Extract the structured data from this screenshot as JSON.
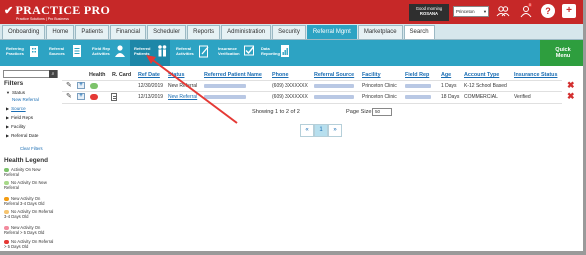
{
  "header": {
    "logo_text": "PRACTICE PRO",
    "logo_sub": "Practice Solutions | Pro Business",
    "greeting_line1": "Good morning",
    "greeting_name": "ROSANA",
    "clinic": "Princeton",
    "badge_count": "0",
    "help_icon": "help-icon",
    "colors": {
      "header_bg": "#c62828",
      "nav_active": "#2da3c3",
      "quick_menu": "#2e9e3e"
    }
  },
  "tabs": [
    "Onboarding",
    "Home",
    "Patients",
    "Financial",
    "Scheduler",
    "Reports",
    "Administration",
    "Security",
    "Referral Mgmt",
    "Marketplace",
    "Search"
  ],
  "subnav": [
    {
      "label1": "Referring",
      "label2": "Practices"
    },
    {
      "label1": "Referral",
      "label2": "Sources"
    },
    {
      "label1": "Field Rep",
      "label2": "Activities"
    },
    {
      "label1": "Referred",
      "label2": "Patients"
    },
    {
      "label1": "Referral",
      "label2": "Activities"
    },
    {
      "label1": "Insurance",
      "label2": "Verification"
    },
    {
      "label1": "Data",
      "label2": "Reporting"
    }
  ],
  "quick_menu": {
    "line1": "Quick",
    "line2": "Menu"
  },
  "filters": {
    "title": "Filters",
    "items": [
      "Status",
      "Source",
      "Field Reps",
      "Facility",
      "Referral Date"
    ],
    "status_value": "New Referral",
    "clear": "Clear Filters"
  },
  "health_legend": {
    "title": "Health Legend",
    "items": [
      {
        "text1": "Activity On New",
        "text2": "Referral",
        "color": "#7dc36b"
      },
      {
        "text1": "No Activity On New",
        "text2": "Referral",
        "color": "#a8d98a"
      },
      {
        "text1": "New Activity On",
        "text2": "Referral 3-4 Days Old",
        "color": "#f39c12"
      },
      {
        "text1": "No Activity On Referral",
        "text2": "3-4 Days Old",
        "color": "#f5c46f"
      },
      {
        "text1": "New Activity On",
        "text2": "Referral > 5 Days Old",
        "color": "#f28b9e"
      },
      {
        "text1": "No Activity On Referral",
        "text2": "> 5 Days Old",
        "color": "#e53935"
      }
    ]
  },
  "table": {
    "headers": [
      "Health",
      "R. Card",
      "Ref Date",
      "Status",
      "Referred Patient Name",
      "Phone",
      "Referral Source",
      "Facility",
      "Field Rep",
      "Age",
      "Account Type",
      "Insurance Status"
    ],
    "rows": [
      {
        "ref_date": "12/30/2019",
        "status": "New Referral",
        "phone": "(609) 3XXXXXX",
        "facility": "Princeton Clinic",
        "age": "1 Days",
        "account_type": "K-12 School Based",
        "insurance_status": "",
        "health_color": "#7dc36b"
      },
      {
        "ref_date": "12/13/2019",
        "status": "New Referral",
        "phone": "(609) 3XXXXXX",
        "facility": "Princeton Clinic",
        "age": "18 Days",
        "account_type": "COMMERCIAL",
        "insurance_status": "Verified",
        "health_color": "#e53935"
      }
    ]
  },
  "pagination": {
    "showing": "Showing 1 to 2 of 2",
    "page_size_label": "Page Size",
    "page_size": "50",
    "prev": "«",
    "current": "1",
    "next": "»"
  }
}
